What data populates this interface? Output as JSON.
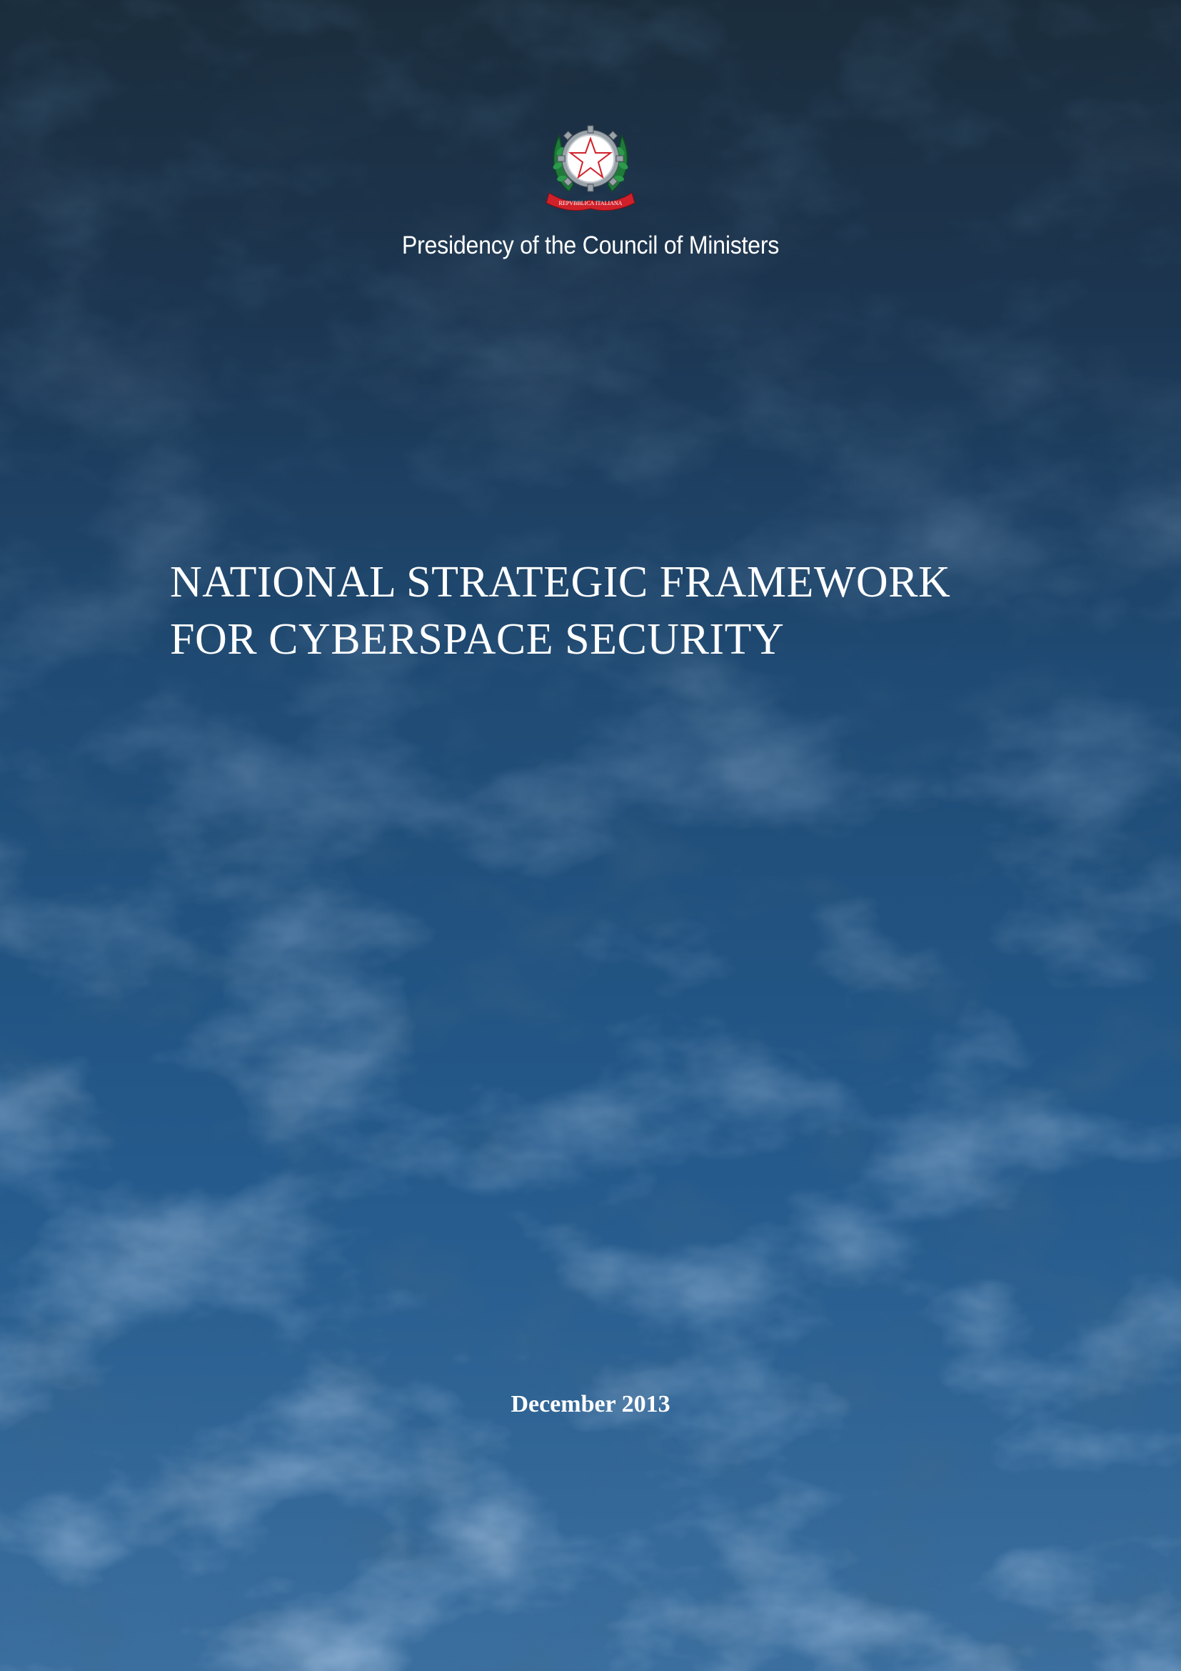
{
  "institution": "Presidency of the Council of Ministers",
  "emblem_text": "REPVBBLICA ITALIANA",
  "title": {
    "line1": "NATIONAL STRATEGIC FRAMEWORK",
    "line2": "FOR CYBERSPACE SECURITY"
  },
  "date": "December 2013",
  "colors": {
    "background_top": "#1c2f3f",
    "background_bottom": "#4a7fb0",
    "text": "#ffffff"
  }
}
